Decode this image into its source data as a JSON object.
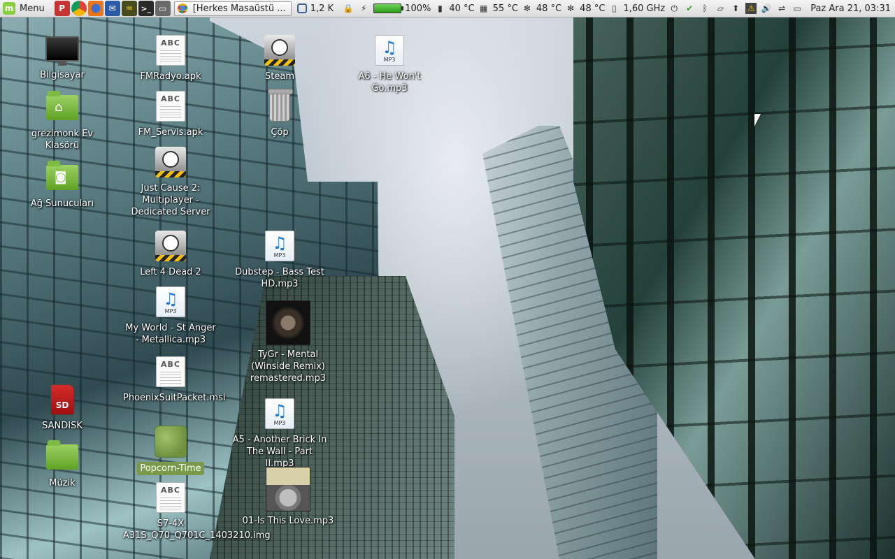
{
  "panel": {
    "menu_label": "Menu",
    "launchers": [
      "pdf-reader",
      "chrome",
      "firefox",
      "thunderbird",
      "system-monitor",
      "terminal",
      "file-manager"
    ],
    "window_title": "[Herkes Masaüstü ...",
    "net_speed": "1,2 K",
    "battery_percent": "100%",
    "temp1": "40 °C",
    "temp2": "55 °C",
    "temp3": "48 °C",
    "temp4": "48 °C",
    "cpu_freq": "1,60 GHz",
    "clock": "Paz Ara 21, 03:31"
  },
  "desktop": {
    "col1": [
      {
        "label": "Bilgisayar",
        "icon": "computer-icon"
      },
      {
        "label": "grezimonk Ev Klasörü",
        "icon": "home-folder-icon"
      },
      {
        "label": "Ağ Sunucuları",
        "icon": "network-folder-icon"
      },
      {
        "label": "SANDISK",
        "icon": "sd-card-icon"
      },
      {
        "label": "Müzik",
        "icon": "music-folder-icon"
      }
    ],
    "col2": [
      {
        "label": "FMRadyo.apk",
        "icon": "document-icon"
      },
      {
        "label": "FM_Servis.apk",
        "icon": "document-icon"
      },
      {
        "label": "Just Cause 2: Multiplayer - Dedicated Server",
        "icon": "steam-icon"
      },
      {
        "label": "Left 4 Dead 2",
        "icon": "steam-icon"
      },
      {
        "label": "My World - St Anger - Metallica.mp3",
        "icon": "mp3-icon"
      },
      {
        "label": "PhoenixSuitPacket.msi",
        "icon": "document-icon"
      },
      {
        "label": "Popcorn-Time",
        "icon": "popcorn-icon"
      },
      {
        "label": "S7-4X A31S_Q70_Q701C_1403210.img",
        "icon": "document-icon"
      }
    ],
    "col3": [
      {
        "label": "Steam",
        "icon": "steam-icon"
      },
      {
        "label": "Çöp",
        "icon": "trash-icon"
      },
      {
        "label": "Dubstep - Bass Test HD.mp3",
        "icon": "mp3-icon"
      },
      {
        "label": "TyGr - Mental (Winside Remix) remastered.mp3",
        "icon": "album-art-icon"
      },
      {
        "label": "A5 - Another Brick In The Wall - Part II.mp3",
        "icon": "mp3-icon"
      },
      {
        "label": "01-Is This Love.mp3",
        "icon": "album-art-icon"
      }
    ],
    "col4": [
      {
        "label": "A6 - He Won't Go.mp3",
        "icon": "mp3-icon"
      }
    ]
  }
}
